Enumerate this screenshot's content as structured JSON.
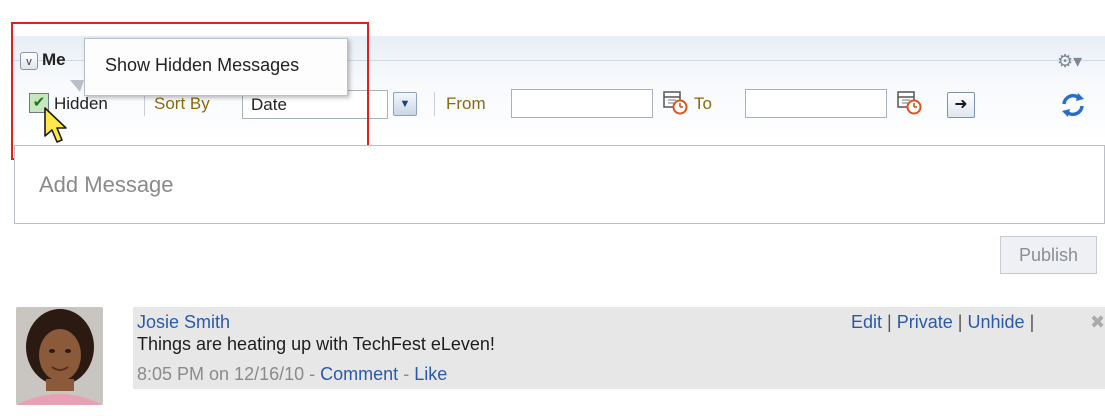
{
  "panel": {
    "title": "Me",
    "collapse_glyph": "v"
  },
  "tooltip": {
    "text": "Show Hidden Messages"
  },
  "toolbar": {
    "hidden_checked": true,
    "hidden_label": "Hidden",
    "sort_by_label": "Sort By",
    "sort_value": "Date",
    "from_label": "From",
    "from_value": "",
    "to_label": "To",
    "to_value": ""
  },
  "composer": {
    "placeholder": "Add Message",
    "publish_label": "Publish"
  },
  "messages": [
    {
      "author": "Josie Smith",
      "body": "Things are heating up with TechFest eLeven!",
      "timestamp": "8:05 PM on 12/16/10",
      "separator": "-",
      "comment_label": "Comment",
      "like_label": "Like",
      "actions": {
        "edit": "Edit",
        "private": "Private",
        "unhide": "Unhide",
        "pipe": "|"
      }
    }
  ],
  "icons": {
    "gear": "gear-icon",
    "calendar": "calendar-icon",
    "go": "arrow-right-icon",
    "refresh": "refresh-icon",
    "delete": "delete-icon"
  },
  "colors": {
    "link": "#2a5aa8",
    "highlight": "#e02020",
    "checkbox_fill": "#c8e6c0"
  }
}
